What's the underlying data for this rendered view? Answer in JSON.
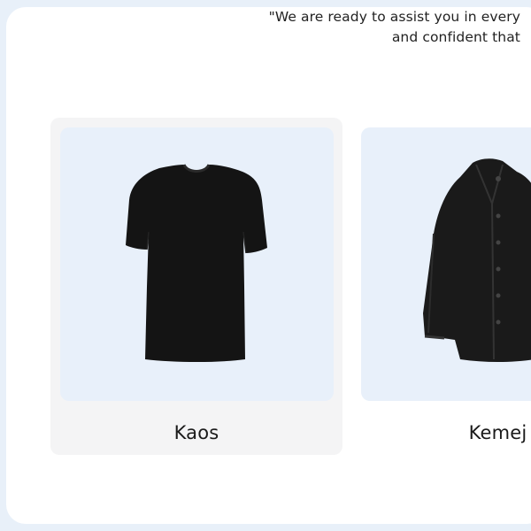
{
  "hero": {
    "quote_line1": "\"We are ready to assist you in every",
    "quote_line2": "and confident that"
  },
  "products": [
    {
      "label": "Kaos",
      "image_icon": "tshirt-icon"
    },
    {
      "label": "Kemej",
      "image_icon": "shirt-icon"
    }
  ],
  "colors": {
    "page_bg": "#e8f0f9",
    "card_bg": "#f4f4f5",
    "image_bg": "#e8f0fa",
    "garment": "#141414"
  }
}
